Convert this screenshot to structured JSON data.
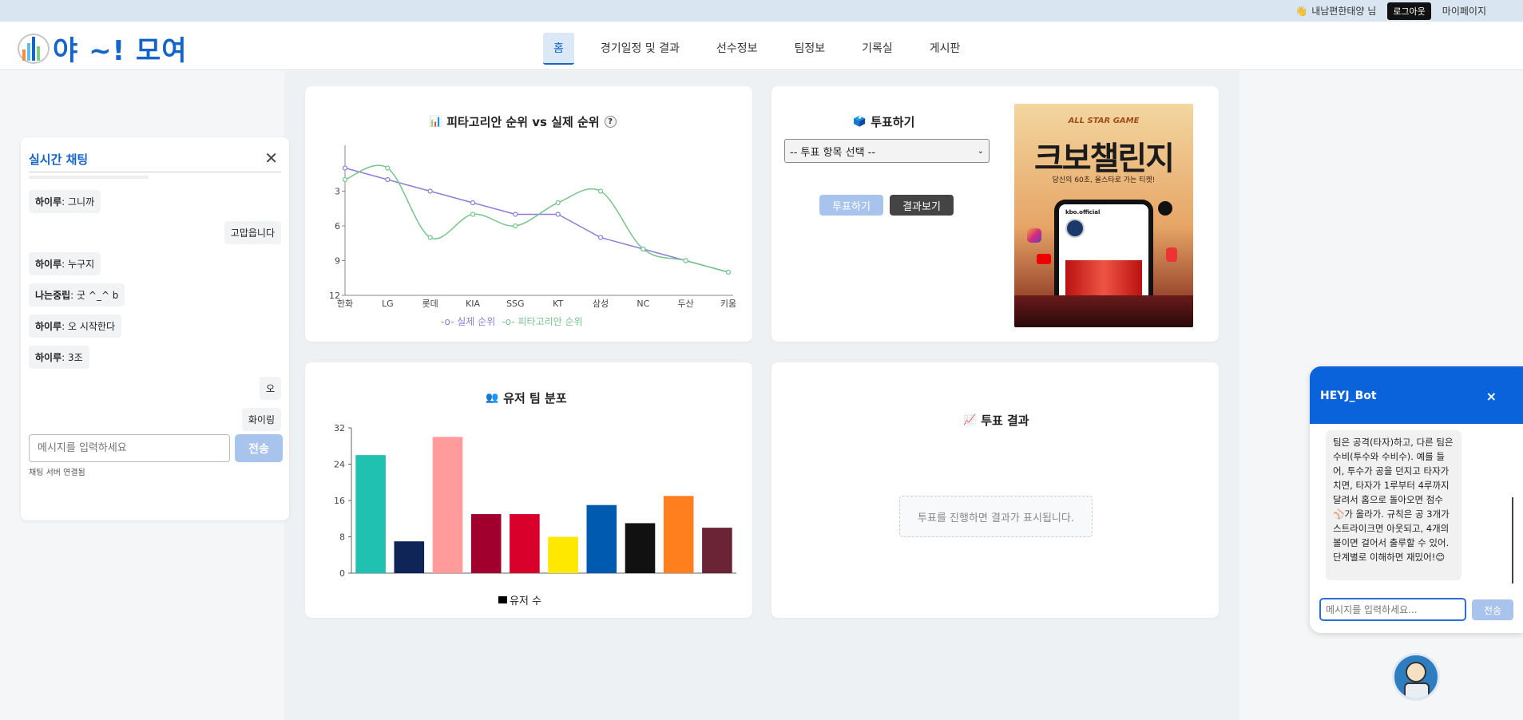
{
  "topbar": {
    "greeting": "내남편한태양 님",
    "logout": "로그아웃",
    "mypage": "마이페이지"
  },
  "logo": {
    "text": "야 ~! 모여"
  },
  "nav": [
    {
      "label": "홈",
      "active": true
    },
    {
      "label": "경기일정 및 결과",
      "active": false
    },
    {
      "label": "선수정보",
      "active": false
    },
    {
      "label": "팀정보",
      "active": false
    },
    {
      "label": "기록실",
      "active": false
    },
    {
      "label": "게시판",
      "active": false
    }
  ],
  "chat": {
    "title": "실시간 채팅",
    "messages": [
      {
        "user": "하이루",
        "text": "그니까",
        "mine": false
      },
      {
        "user": "",
        "text": "고맙읍니다",
        "mine": true
      },
      {
        "user": "하이루",
        "text": "누구지",
        "mine": false
      },
      {
        "user": "나는중립",
        "text": "굿 ^_^ b",
        "mine": false
      },
      {
        "user": "하이루",
        "text": "오 시작한다",
        "mine": false
      },
      {
        "user": "하이루",
        "text": "3조",
        "mine": false
      },
      {
        "user": "",
        "text": "오",
        "mine": true
      },
      {
        "user": "",
        "text": "화이링",
        "mine": true
      }
    ],
    "placeholder": "메시지를 입력하세요",
    "send": "전송",
    "status": "채팅 서버 연결됨"
  },
  "pyth": {
    "title": "피타고리안 순위 vs 실제 순위",
    "help": "?",
    "legend_actual": "실제 순위",
    "legend_pyth": "피타고리안 순위"
  },
  "team_dist": {
    "title": "유저 팀 분포",
    "legend": "유저 수"
  },
  "vote": {
    "title": "투표하기",
    "select": "-- 투표 항목 선택 --",
    "vote_btn": "투표하기",
    "result_btn": "결과보기",
    "poster_top": "ALL STAR GAME",
    "poster_main": "크보챌린지",
    "poster_sub": "당신의 60초, 올스타로 가는 티켓!",
    "poster_account": "kbo.official"
  },
  "vote_result": {
    "title": "투표 결과",
    "empty": "투표를 진행하면 결과가 표시됩니다."
  },
  "bot": {
    "name": "HEYJ_Bot",
    "close": "×",
    "message": "팀은 공격(타자)하고, 다른 팀은 수비(투수와 수비수). 예를 들어, 투수가 공을 던지고 타자가 치면, 타자가 1루부터 4루까지 달려서 홈으로 돌아오면 점수⚾가 올라가. 규칙은 공 3개가 스트라이크면 아웃되고, 4개의 볼이면 걸어서 출루할 수 있어. 단계별로 이해하면 재밌어!😊",
    "placeholder": "메시지를 입력하세요...",
    "send": "전송"
  },
  "chart_data": [
    {
      "type": "line",
      "title": "피타고리안 순위 vs 실제 순위",
      "categories": [
        "한화",
        "LG",
        "롯데",
        "KIA",
        "SSG",
        "KT",
        "삼성",
        "NC",
        "두산",
        "키움"
      ],
      "series": [
        {
          "name": "실제 순위",
          "color": "#8a7fd8",
          "values": [
            1,
            2,
            3,
            4,
            5,
            5,
            7,
            8,
            9,
            10
          ]
        },
        {
          "name": "피타고리안 순위",
          "color": "#77c48a",
          "values": [
            2,
            1,
            7,
            5,
            6,
            4,
            3,
            8,
            9,
            10
          ]
        }
      ],
      "y_ticks": [
        3,
        6,
        9,
        12
      ],
      "ylim": [
        0,
        12
      ],
      "y_reversed": true,
      "legend": "bottom"
    },
    {
      "type": "bar",
      "title": "유저 팀 분포",
      "categories": [
        "",
        "",
        "",
        "",
        "",
        "",
        "",
        "",
        "",
        ""
      ],
      "values": [
        26,
        7,
        30,
        13,
        13,
        8,
        15,
        11,
        17,
        10
      ],
      "colors": [
        "#20c1b0",
        "#0f2557",
        "#ff9b9b",
        "#a1002e",
        "#d9002c",
        "#ffe800",
        "#005ab0",
        "#111111",
        "#ff7f1e",
        "#6b2336"
      ],
      "y_ticks": [
        0,
        8,
        16,
        24,
        32
      ],
      "ylim": [
        0,
        32
      ],
      "legend": "bottom",
      "series_name": "유저 수"
    }
  ]
}
